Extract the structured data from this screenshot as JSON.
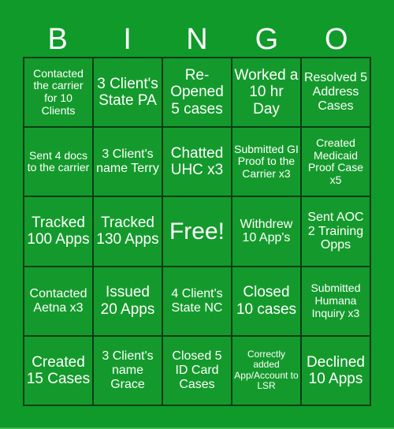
{
  "header": {
    "letters": [
      "B",
      "I",
      "N",
      "G",
      "O"
    ]
  },
  "cells": [
    [
      "Contacted the carrier for 10 Clients",
      "3 Client's State PA",
      "Re-Opened 5 cases",
      "Worked a 10 hr Day",
      "Resolved 5 Address Cases"
    ],
    [
      "Sent 4 docs to the carrier",
      "3 Client's name Terry",
      "Chatted UHC x3",
      "Submitted GI Proof to the Carrier x3",
      "Created Medicaid Proof Case x5"
    ],
    [
      "Tracked 100 Apps",
      "Tracked 130 Apps",
      "Free!",
      "Withdrew 10 App's",
      "Sent AOC 2 Training Opps"
    ],
    [
      "Contacted Aetna x3",
      "Issued 20 Apps",
      "4 Client's State NC",
      "Closed 10 cases",
      "Submitted Humana Inquiry x3"
    ],
    [
      "Created 15 Cases",
      "3 Client's name Grace",
      "Closed 5 ID Card Cases",
      "Correctly added App/Account to LSR",
      "Declined 10 Apps"
    ]
  ],
  "colors": {
    "background": "#0f9a2a",
    "cell": "#149a2c",
    "border": "#0b3d14",
    "text": "#ffffff"
  }
}
